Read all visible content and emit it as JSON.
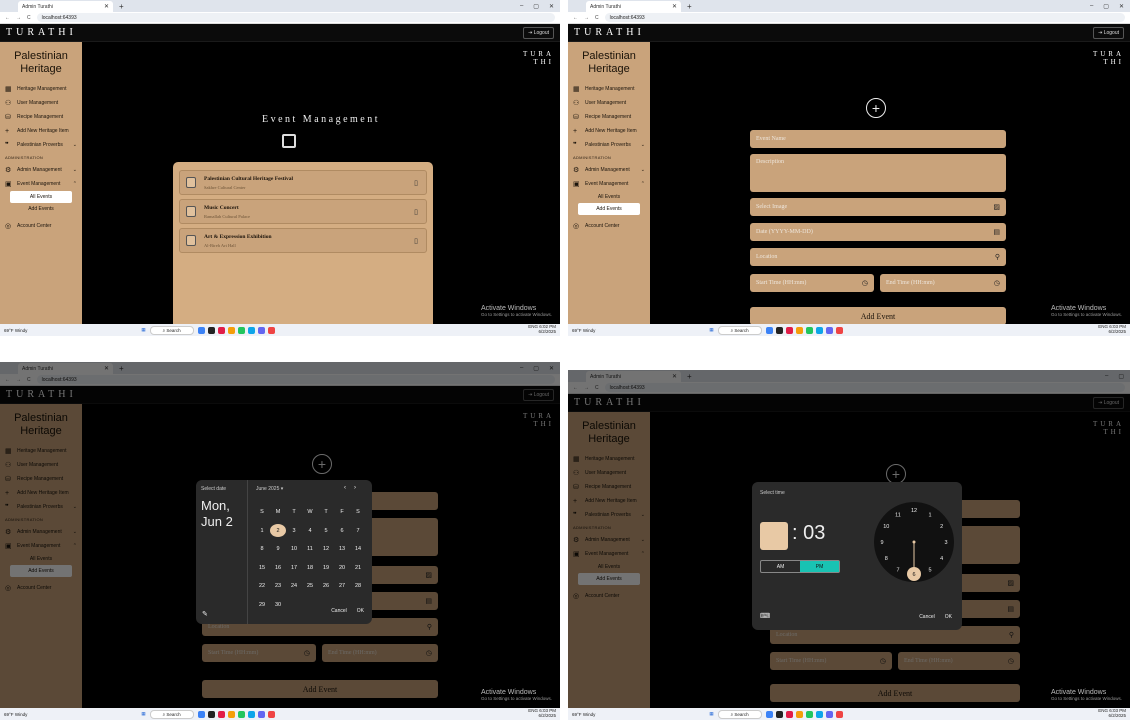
{
  "browser": {
    "tab_title": "Admin Turathi",
    "url": "localhost:64393",
    "new_tab": "+",
    "win": [
      "–",
      "▢",
      "✕"
    ]
  },
  "app": {
    "logo": "TURATHI",
    "logout": "Logout",
    "mark": [
      "TURA",
      "THI"
    ]
  },
  "sidebar": {
    "brand": [
      "Palestinian",
      "Heritage"
    ],
    "items": [
      {
        "icon": "grid-icon",
        "glyph": "▦",
        "label": "Heritage Management"
      },
      {
        "icon": "users-icon",
        "glyph": "⚇",
        "label": "User Management"
      },
      {
        "icon": "recipe-icon",
        "glyph": "⛁",
        "label": "Recipe Management"
      },
      {
        "icon": "plus-icon",
        "glyph": "+",
        "label": "Add New Heritage Item"
      },
      {
        "icon": "quote-icon",
        "glyph": "❞",
        "label": "Palestinian Proverbs"
      }
    ],
    "section": "ADMINISTRATION",
    "admin": [
      {
        "icon": "admin-icon",
        "glyph": "⚙",
        "label": "Admin Management"
      },
      {
        "icon": "calendar-icon",
        "glyph": "▣",
        "label": "Event Management"
      }
    ],
    "sub": [
      "All Events",
      "Add Events"
    ],
    "account": "Account Center"
  },
  "q1": {
    "heading": "Event Management",
    "events": [
      {
        "title": "Palestinian Cultural Heritage Festival",
        "place": "Sakhre Cultural Center"
      },
      {
        "title": "Music Concert",
        "place": "Ramallah Cultural Palace"
      },
      {
        "title": "Art & Expression Exhibition",
        "place": "Al-Bireh Art Hall"
      }
    ]
  },
  "form": {
    "event_name": "Event Name",
    "description": "Description",
    "select_image": "Select Image",
    "date": "Date (YYYY-MM-DD)",
    "location": "Location",
    "start": "Start Time (HH:mm)",
    "end": "End Time (HH:mm)",
    "add": "Add Event"
  },
  "datepicker": {
    "label": "Select date",
    "date": [
      "Mon,",
      "Jun 2"
    ],
    "month": "June 2025",
    "weekdays": [
      "S",
      "M",
      "T",
      "W",
      "T",
      "F",
      "S"
    ],
    "days": [
      [
        null,
        1,
        2,
        3,
        4,
        5,
        6,
        7
      ],
      [
        8,
        9,
        10,
        11,
        12,
        13,
        14
      ],
      [
        15,
        16,
        17,
        18,
        19,
        20,
        21
      ],
      [
        22,
        23,
        24,
        25,
        26,
        27,
        28
      ],
      [
        29,
        30
      ]
    ],
    "selected": 2,
    "cancel": "Cancel",
    "ok": "OK"
  },
  "timepicker": {
    "label": "Select time",
    "minute": "03",
    "am": "AM",
    "pm": "PM",
    "selected_hour": 6,
    "cancel": "Cancel",
    "ok": "OK"
  },
  "windows": {
    "activate": "Activate Windows",
    "activate_sub": "Go to Settings to activate Windows."
  },
  "taskbar": {
    "weather_temp": "69°F",
    "weather": "Windy",
    "search": "Search",
    "lang": "ENG",
    "times": [
      "6:02 PM",
      "6:03 PM",
      "6:03 PM",
      "6:03 PM"
    ],
    "date": "6/2/2025"
  }
}
